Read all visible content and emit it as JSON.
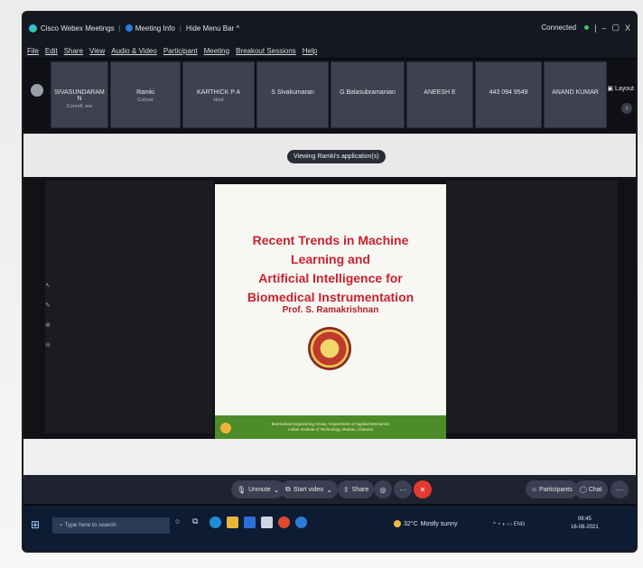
{
  "title_bar": {
    "app_name": "Cisco Webex Meetings",
    "meeting_info": "Meeting Info",
    "hide_menu": "Hide Menu Bar ^",
    "status": "Connected",
    "pipe": "|",
    "minimize": "–",
    "maximize": "▢",
    "close": "X"
  },
  "menu": [
    "File",
    "Edit",
    "Share",
    "View",
    "Audio & Video",
    "Participant",
    "Meeting",
    "Breakout Sessions",
    "Help"
  ],
  "participants": [
    {
      "name": "SIVASUNDARAM N",
      "sub": "Cornell, ww"
    },
    {
      "name": "Ramki",
      "sub": "Cohost"
    },
    {
      "name": "KARTHICK P A",
      "sub": "Host"
    },
    {
      "name": "S Sivakumaran",
      "sub": ""
    },
    {
      "name": "G.Balasubramanian",
      "sub": ""
    },
    {
      "name": "ANEESH E",
      "sub": ""
    },
    {
      "name": "443 094 9549",
      "sub": ""
    },
    {
      "name": "ANAND KUMAR",
      "sub": ""
    }
  ],
  "layout_label": "Layout",
  "viewing_label": "Viewing Ramki's application(s)",
  "slide": {
    "title_line1": "Recent Trends in Machine Learning and",
    "title_line2": "Artificial Intelligence for",
    "title_line3": "Biomedical Instrumentation",
    "author": "Prof. S. Ramakrishnan",
    "footer_line1": "Biomedical Engineering Group, Department of Applied Mechanics",
    "footer_line2": "Indian Institute of Technology Madras, Chennai"
  },
  "controls": {
    "unmute": "Unmute",
    "start_video": "Start video",
    "share": "Share",
    "participants": "Participants",
    "chat": "Chat"
  },
  "taskbar": {
    "search_placeholder": "Type here to search",
    "temperature": "32°C",
    "weather": "Mostly sunny",
    "language": "ENG",
    "time": "09:45",
    "date": "16-08-2021"
  },
  "colors": {
    "slide_title": "#c8222e",
    "slide_footer": "#4d8c28",
    "end_button": "#e23a2f",
    "connected": "#39c86a"
  }
}
